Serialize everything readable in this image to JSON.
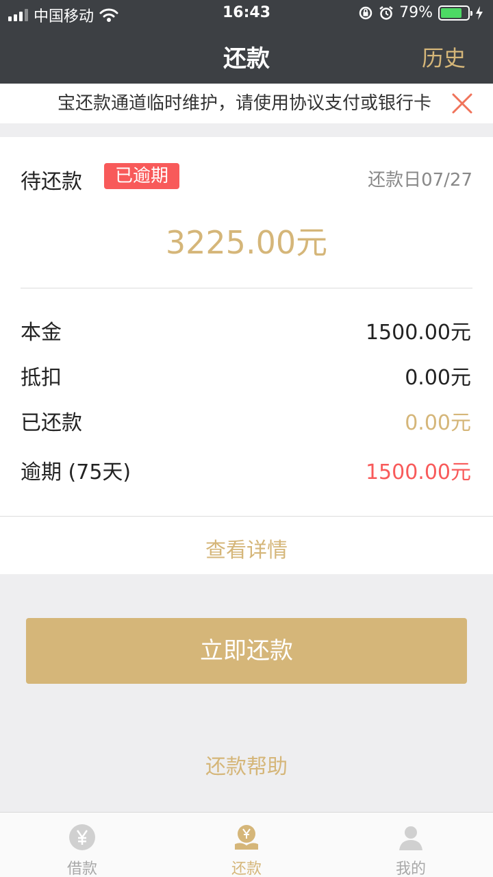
{
  "status_bar": {
    "carrier": "中国移动",
    "time": "16:43",
    "battery": "79%",
    "battery_level": 0.79
  },
  "nav": {
    "title": "还款",
    "history": "历史"
  },
  "notice": {
    "text": "宝还款通道临时维护，请使用协议支付或银行卡"
  },
  "card": {
    "pending_label": "待还款",
    "overdue_badge": "已逾期",
    "due_date": "还款日07/27",
    "total_amount": "3225.00元",
    "rows": [
      {
        "label": "本金",
        "value": "1500.00元"
      },
      {
        "label": "抵扣",
        "value": "0.00元"
      },
      {
        "label": "已还款",
        "value": "0.00元"
      },
      {
        "label": "逾期 (75天)",
        "value": "1500.00元"
      }
    ],
    "detail_link": "查看详情"
  },
  "actions": {
    "pay_button": "立即还款",
    "help_link": "还款帮助"
  },
  "tabs": [
    {
      "label": "借款",
      "icon": "yen-coin-icon",
      "active": false
    },
    {
      "label": "还款",
      "icon": "repay-coin-icon",
      "active": true
    },
    {
      "label": "我的",
      "icon": "user-icon",
      "active": false
    }
  ],
  "colors": {
    "accent": "#d5b679",
    "overdue": "#f85a5a",
    "topbar": "#3d4044"
  }
}
